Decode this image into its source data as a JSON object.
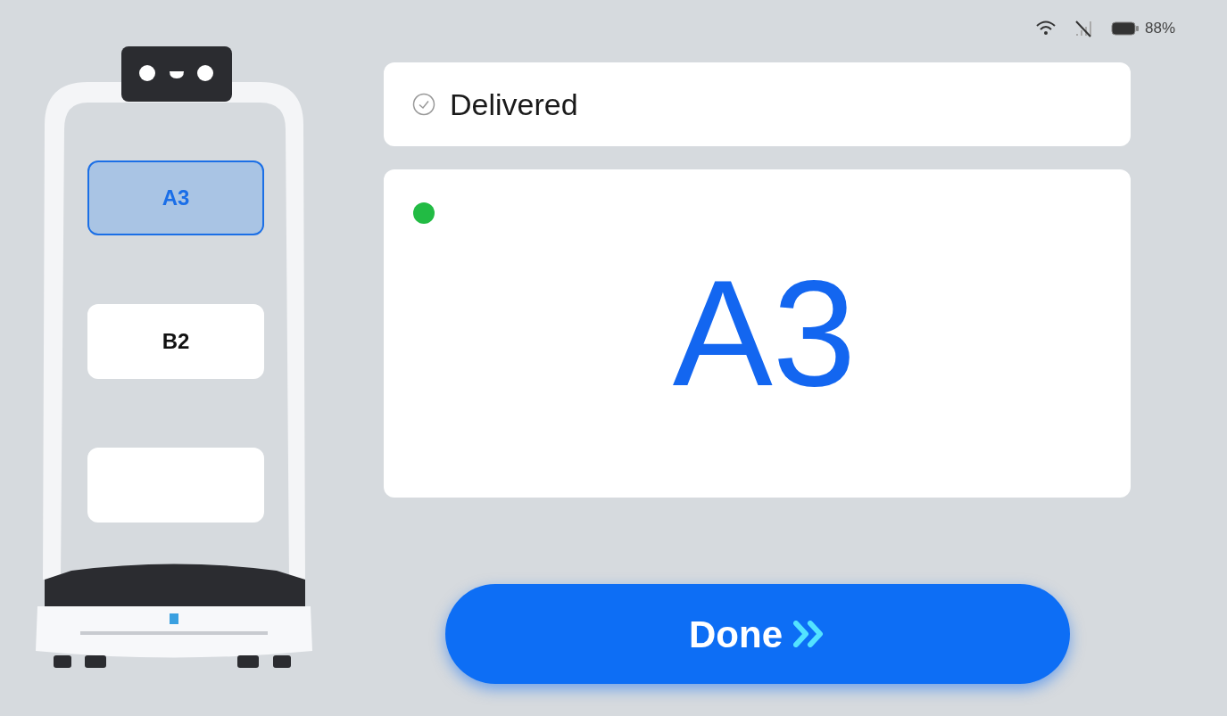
{
  "status_bar": {
    "battery": "88%"
  },
  "robot": {
    "trays": [
      {
        "label": "A3",
        "selected": true
      },
      {
        "label": "B2",
        "selected": false
      },
      {
        "selected": false
      }
    ]
  },
  "status": {
    "text": "Delivered",
    "done": true
  },
  "destination": {
    "label": "A3",
    "color": "#22bb44"
  },
  "done_button": {
    "label": "Done"
  }
}
